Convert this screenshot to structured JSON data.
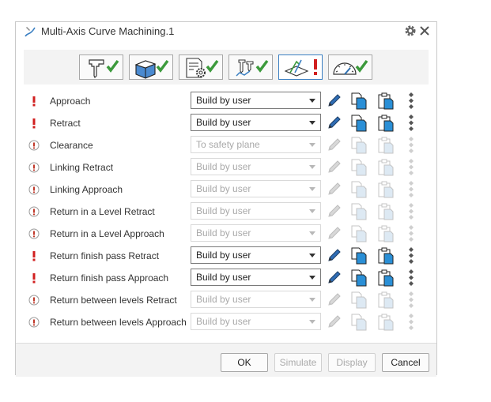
{
  "dialog": {
    "title": "Multi-Axis Curve Machining.1"
  },
  "tabs": [
    {
      "name": "tool-tab",
      "status": "ok"
    },
    {
      "name": "geometry-tab",
      "status": "ok"
    },
    {
      "name": "parameters-tab",
      "status": "ok"
    },
    {
      "name": "strategy-tab",
      "status": "ok"
    },
    {
      "name": "macros-tab",
      "status": "error"
    },
    {
      "name": "feeds-speeds-tab",
      "status": "ok"
    }
  ],
  "rows": [
    {
      "label": "Approach",
      "value": "Build by user",
      "enabled": true,
      "status": "required"
    },
    {
      "label": "Retract",
      "value": "Build by user",
      "enabled": true,
      "status": "required"
    },
    {
      "label": "Clearance",
      "value": "To safety plane",
      "enabled": false,
      "status": "inactive"
    },
    {
      "label": "Linking Retract",
      "value": "Build by user",
      "enabled": false,
      "status": "inactive"
    },
    {
      "label": "Linking Approach",
      "value": "Build by user",
      "enabled": false,
      "status": "inactive"
    },
    {
      "label": "Return in a Level Retract",
      "value": "Build by user",
      "enabled": false,
      "status": "inactive"
    },
    {
      "label": "Return in a Level Approach",
      "value": "Build by user",
      "enabled": false,
      "status": "inactive"
    },
    {
      "label": "Return finish pass Retract",
      "value": "Build by user",
      "enabled": true,
      "status": "required"
    },
    {
      "label": "Return finish pass Approach",
      "value": "Build by user",
      "enabled": true,
      "status": "required"
    },
    {
      "label": "Return between levels Retract",
      "value": "Build by user",
      "enabled": false,
      "status": "inactive"
    },
    {
      "label": "Return between levels Approach",
      "value": "Build by user",
      "enabled": false,
      "status": "inactive"
    }
  ],
  "buttons": {
    "ok": "OK",
    "simulate": "Simulate",
    "display": "Display",
    "cancel": "Cancel"
  },
  "colors": {
    "check": "#3c9a3c",
    "error": "#d11f1f",
    "accent": "#3a7fc2",
    "inactive_mark": "#c0392b"
  }
}
